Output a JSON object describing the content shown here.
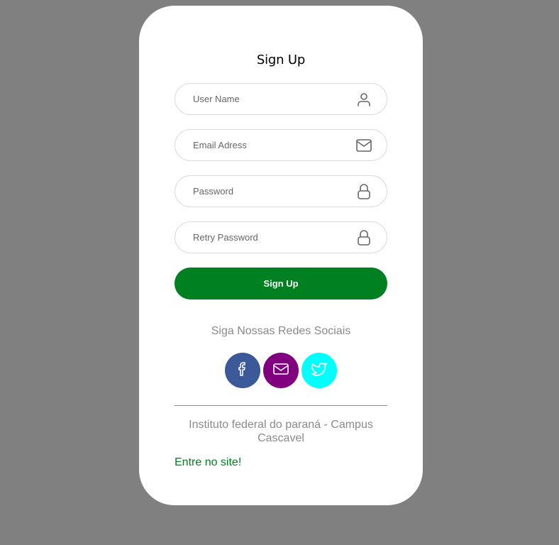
{
  "form": {
    "title": "Sign Up",
    "fields": [
      {
        "placeholder": "User Name",
        "value": "",
        "icon": "user-icon"
      },
      {
        "placeholder": "Email Adress",
        "value": "",
        "icon": "envelope-icon"
      },
      {
        "placeholder": "Password",
        "value": "",
        "icon": "lock-icon"
      },
      {
        "placeholder": "Retry Password",
        "value": "",
        "icon": "lock-icon"
      }
    ],
    "submit_label": "Sign Up"
  },
  "social": {
    "title": "Siga Nossas Redes Sociais",
    "buttons": [
      {
        "icon": "facebook-icon",
        "color": "#3b5998"
      },
      {
        "icon": "mail-icon",
        "color": "#800080"
      },
      {
        "icon": "twitter-icon",
        "color": "#00ffff"
      }
    ]
  },
  "footer": {
    "institute": "Instituto federal do paraná - Campus Cascavel",
    "link_label": "Entre no site!"
  },
  "colors": {
    "background": "#808080",
    "accent": "#008021"
  }
}
